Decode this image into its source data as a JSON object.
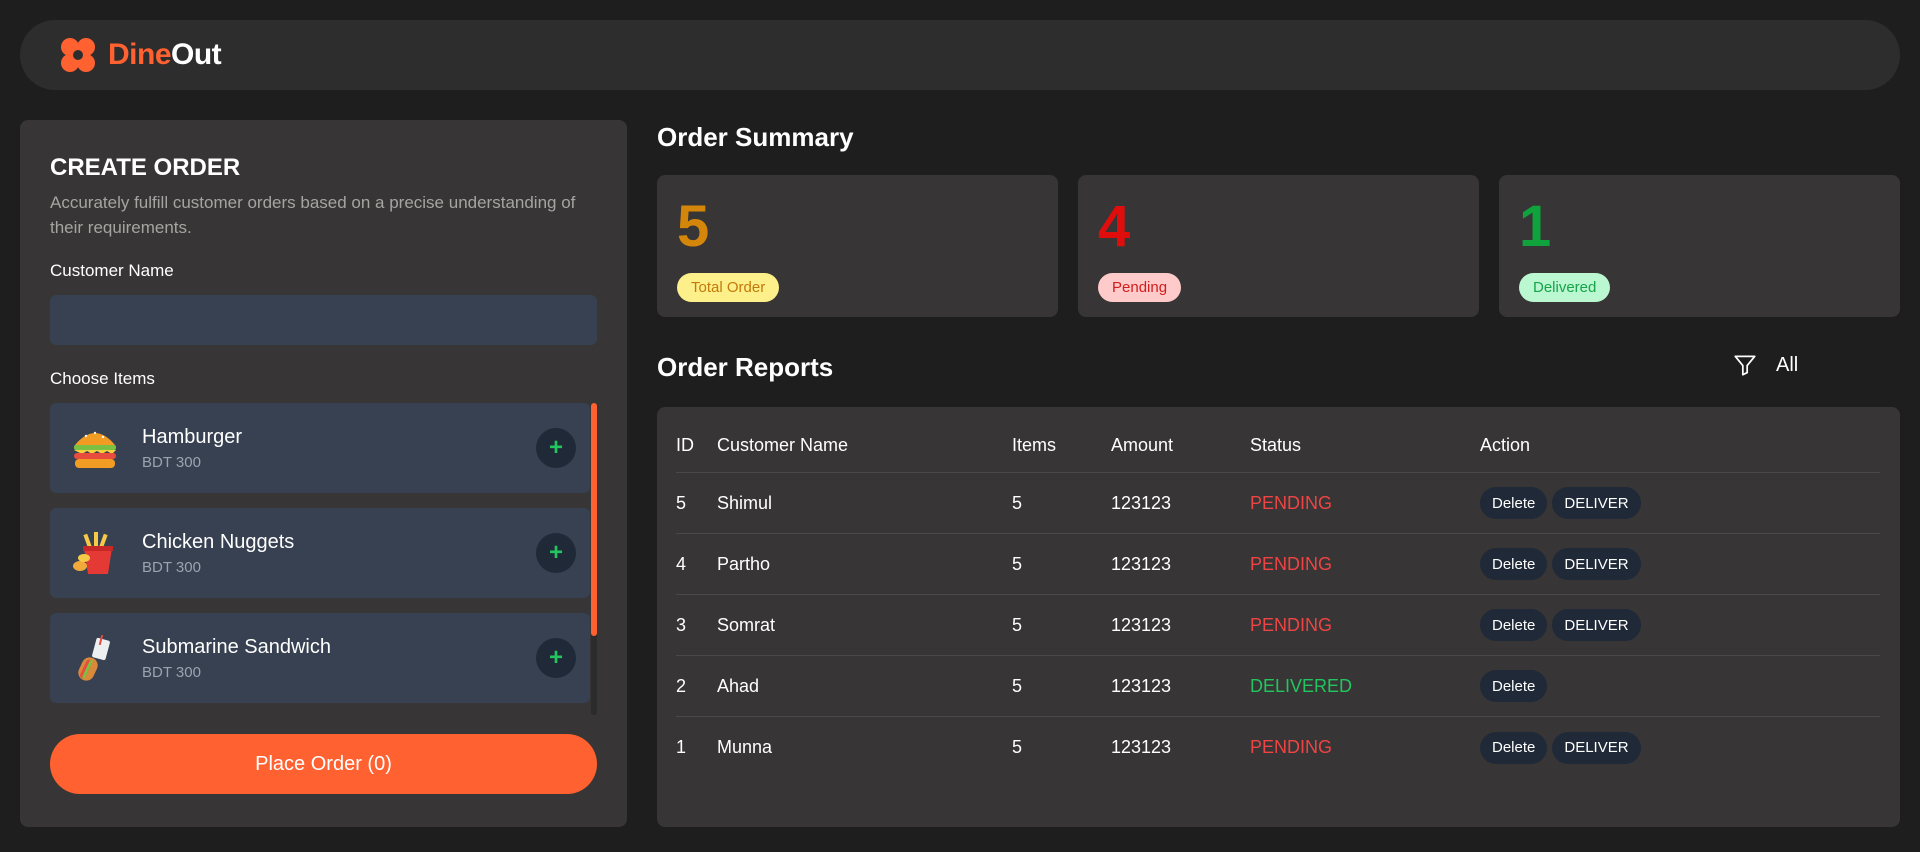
{
  "app": {
    "logo_part1": "Dine",
    "logo_part2": "Out",
    "brand_color": "#ff6130"
  },
  "create_order": {
    "title": "CREATE ORDER",
    "description": "Accurately fulfill customer orders based on a precise understanding of their requirements.",
    "customer_label": "Customer Name",
    "customer_value": "",
    "items_label": "Choose Items",
    "items": [
      {
        "name": "Hamburger",
        "price": "BDT 300",
        "icon": "hamburger-icon",
        "add": "+"
      },
      {
        "name": "Chicken Nuggets",
        "price": "BDT 300",
        "icon": "chicken-nuggets-icon",
        "add": "+"
      },
      {
        "name": "Submarine Sandwich",
        "price": "BDT 300",
        "icon": "sandwich-icon",
        "add": "+"
      }
    ],
    "place_order_label": "Place Order (0)"
  },
  "summary": {
    "title": "Order Summary",
    "cards": [
      {
        "value": "5",
        "label": "Total Order",
        "color": "#d4860b",
        "badge_bg": "#fdf08a",
        "badge_fg": "#c2790a"
      },
      {
        "value": "4",
        "label": "Pending",
        "color": "#e00d0d",
        "badge_bg": "#fecaca",
        "badge_fg": "#d21d1d"
      },
      {
        "value": "1",
        "label": "Delivered",
        "color": "#10a33d",
        "badge_bg": "#bbf7d0",
        "badge_fg": "#16a34a"
      }
    ]
  },
  "reports": {
    "title": "Order Reports",
    "filter_label": "All",
    "columns": [
      "ID",
      "Customer Name",
      "Items",
      "Amount",
      "Status",
      "Action"
    ],
    "rows": [
      {
        "id": "5",
        "name": "Shimul",
        "items": "5",
        "amount": "123123",
        "status": "PENDING",
        "actions": [
          "Delete",
          "DELIVER"
        ]
      },
      {
        "id": "4",
        "name": "Partho",
        "items": "5",
        "amount": "123123",
        "status": "PENDING",
        "actions": [
          "Delete",
          "DELIVER"
        ]
      },
      {
        "id": "3",
        "name": "Somrat",
        "items": "5",
        "amount": "123123",
        "status": "PENDING",
        "actions": [
          "Delete",
          "DELIVER"
        ]
      },
      {
        "id": "2",
        "name": "Ahad",
        "items": "5",
        "amount": "123123",
        "status": "DELIVERED",
        "actions": [
          "Delete"
        ]
      },
      {
        "id": "1",
        "name": "Munna",
        "items": "5",
        "amount": "123123",
        "status": "PENDING",
        "actions": [
          "Delete",
          "DELIVER"
        ]
      }
    ]
  }
}
